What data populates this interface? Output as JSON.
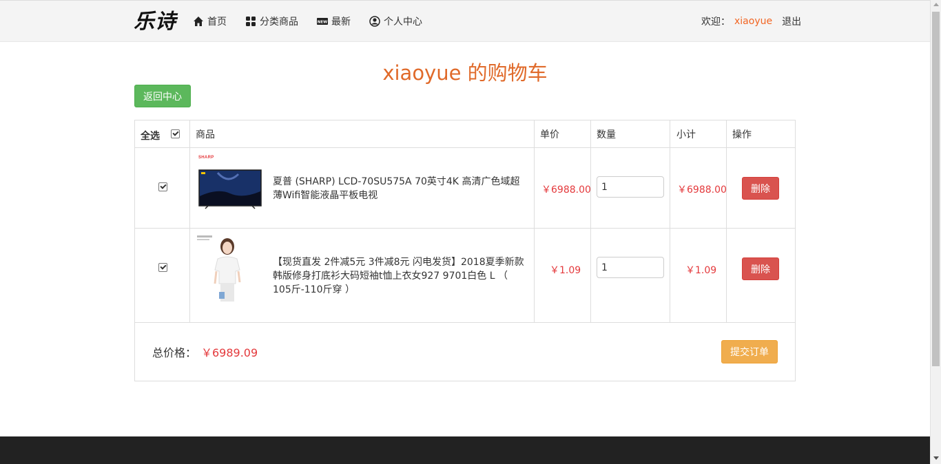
{
  "nav": {
    "logo": "乐诗",
    "items": [
      {
        "label": "首页",
        "icon": "home-icon"
      },
      {
        "label": "分类商品",
        "icon": "grid-icon"
      },
      {
        "label": "最新",
        "icon": "new-badge-icon"
      },
      {
        "label": "个人中心",
        "icon": "user-circle-icon"
      }
    ],
    "welcome_label": "欢迎：",
    "username": "xiaoyue",
    "logout": "退出"
  },
  "page": {
    "title": "xiaoyue 的购物车",
    "back_button": "返回中心"
  },
  "cart": {
    "headers": {
      "select_all": "全选",
      "product": "商品",
      "unit_price": "单价",
      "quantity": "数量",
      "subtotal": "小计",
      "action": "操作"
    },
    "items": [
      {
        "checked": true,
        "name": "夏普 (SHARP) LCD-70SU575A 70英寸4K 高清广色域超薄Wifi智能液晶平板电视",
        "brand_mark": "SHARP",
        "price": "￥6988.00",
        "quantity": "1",
        "subtotal": "￥6988.00",
        "delete": "删除"
      },
      {
        "checked": true,
        "name": "【现货直发 2件减5元 3件减8元 闪电发货】2018夏季新款韩版修身打底衫大码短袖t恤上衣女927 9701白色 L （ 105斤-110斤穿 ）",
        "brand_mark": "",
        "price": "￥1.09",
        "quantity": "1",
        "subtotal": "￥1.09",
        "delete": "删除"
      }
    ],
    "total_label": "总价格：",
    "total_value": "￥6989.09",
    "submit": "提交订单"
  },
  "colors": {
    "accent": "#e06a2a",
    "price": "#e4393c",
    "success": "#5cb85c",
    "danger": "#d9534f",
    "warning": "#f0ad4e"
  }
}
